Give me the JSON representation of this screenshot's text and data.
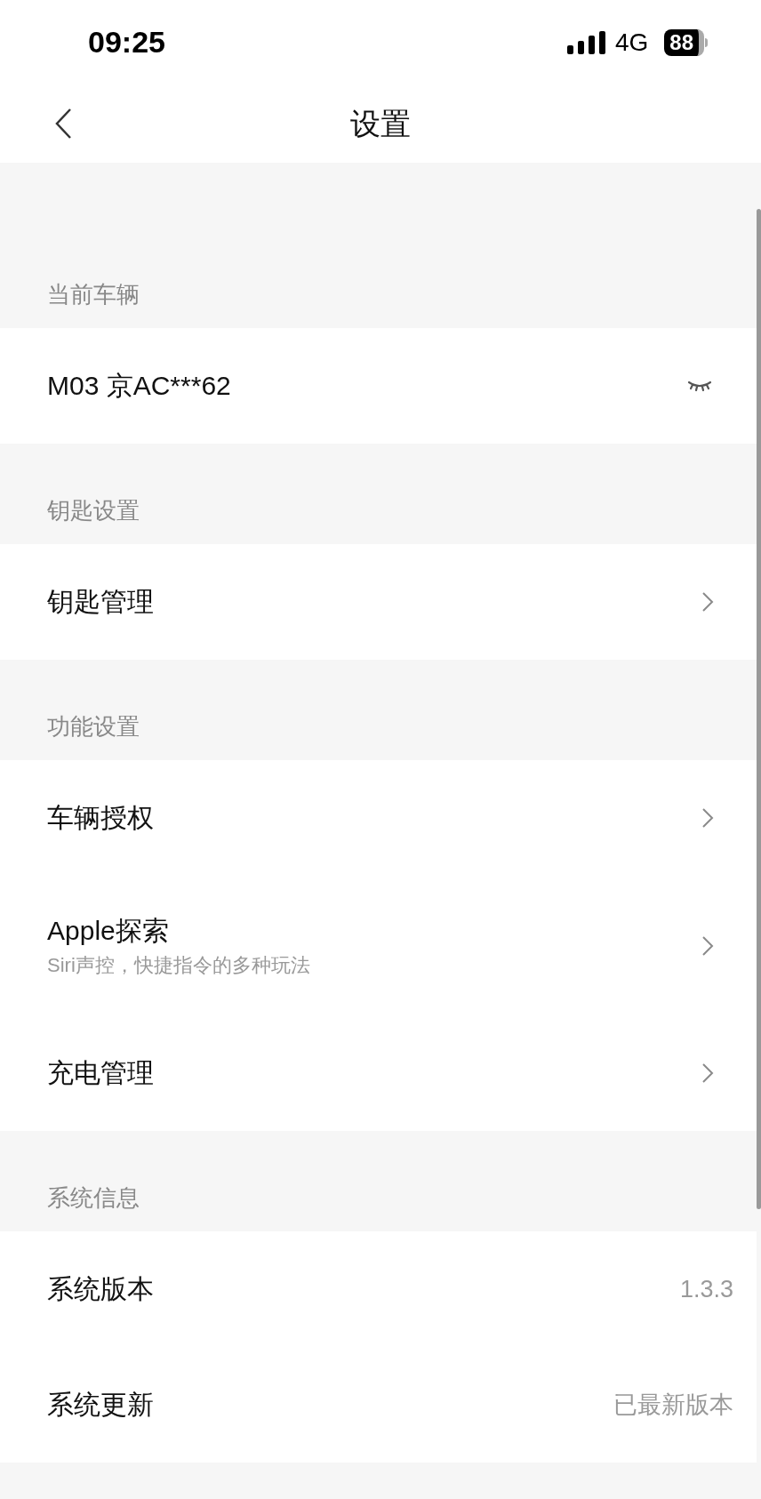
{
  "status_bar": {
    "time": "09:25",
    "network": "4G",
    "battery": "88"
  },
  "header": {
    "title": "设置"
  },
  "sections": [
    {
      "title": "当前车辆",
      "rows": [
        {
          "kind": "eye",
          "label": "M03 京AC***62"
        }
      ]
    },
    {
      "title": "钥匙设置",
      "rows": [
        {
          "kind": "chevron",
          "label": "钥匙管理"
        }
      ]
    },
    {
      "title": "功能设置",
      "rows": [
        {
          "kind": "chevron",
          "label": "车辆授权"
        },
        {
          "kind": "chevron",
          "label": "Apple探索",
          "subtitle": "Siri声控，快捷指令的多种玩法"
        },
        {
          "kind": "chevron",
          "label": "充电管理"
        }
      ]
    },
    {
      "title": "系统信息",
      "rows": [
        {
          "kind": "value",
          "label": "系统版本",
          "value": "1.3.3"
        },
        {
          "kind": "value",
          "label": "系统更新",
          "value": "已最新版本"
        }
      ]
    }
  ]
}
